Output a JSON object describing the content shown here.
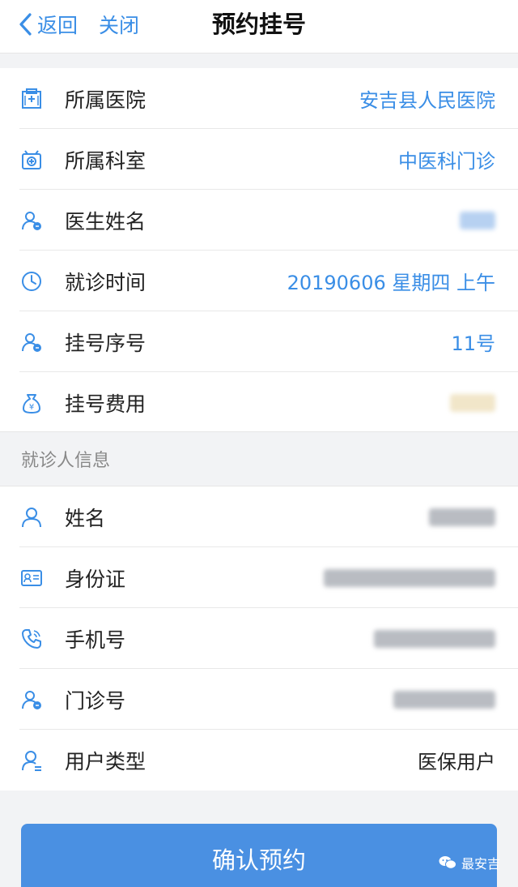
{
  "nav": {
    "back_label": "返回",
    "close_label": "关闭",
    "title": "预约挂号"
  },
  "appointment": {
    "rows": [
      {
        "label": "所属医院",
        "value": "安吉县人民医院",
        "icon": "hospital-icon"
      },
      {
        "label": "所属科室",
        "value": "中医科门诊",
        "icon": "department-icon"
      },
      {
        "label": "医生姓名",
        "value": "",
        "icon": "doctor-icon"
      },
      {
        "label": "就诊时间",
        "value": "20190606 星期四 上午",
        "icon": "clock-icon"
      },
      {
        "label": "挂号序号",
        "value": "11号",
        "icon": "ticket-person-icon"
      },
      {
        "label": "挂号费用",
        "value": "",
        "icon": "money-bag-icon"
      }
    ]
  },
  "patient_section": {
    "header": "就诊人信息",
    "rows": [
      {
        "label": "姓名",
        "value": "",
        "icon": "person-icon"
      },
      {
        "label": "身份证",
        "value": "",
        "icon": "id-card-icon"
      },
      {
        "label": "手机号",
        "value": "",
        "icon": "phone-icon"
      },
      {
        "label": "门诊号",
        "value": "",
        "icon": "clinic-number-icon"
      },
      {
        "label": "用户类型",
        "value": "医保用户",
        "icon": "user-type-icon"
      }
    ]
  },
  "confirm_button": "确认预约",
  "watermark": "最安吉",
  "colors": {
    "accent": "#3a8ee6",
    "button": "#4a90e2"
  }
}
